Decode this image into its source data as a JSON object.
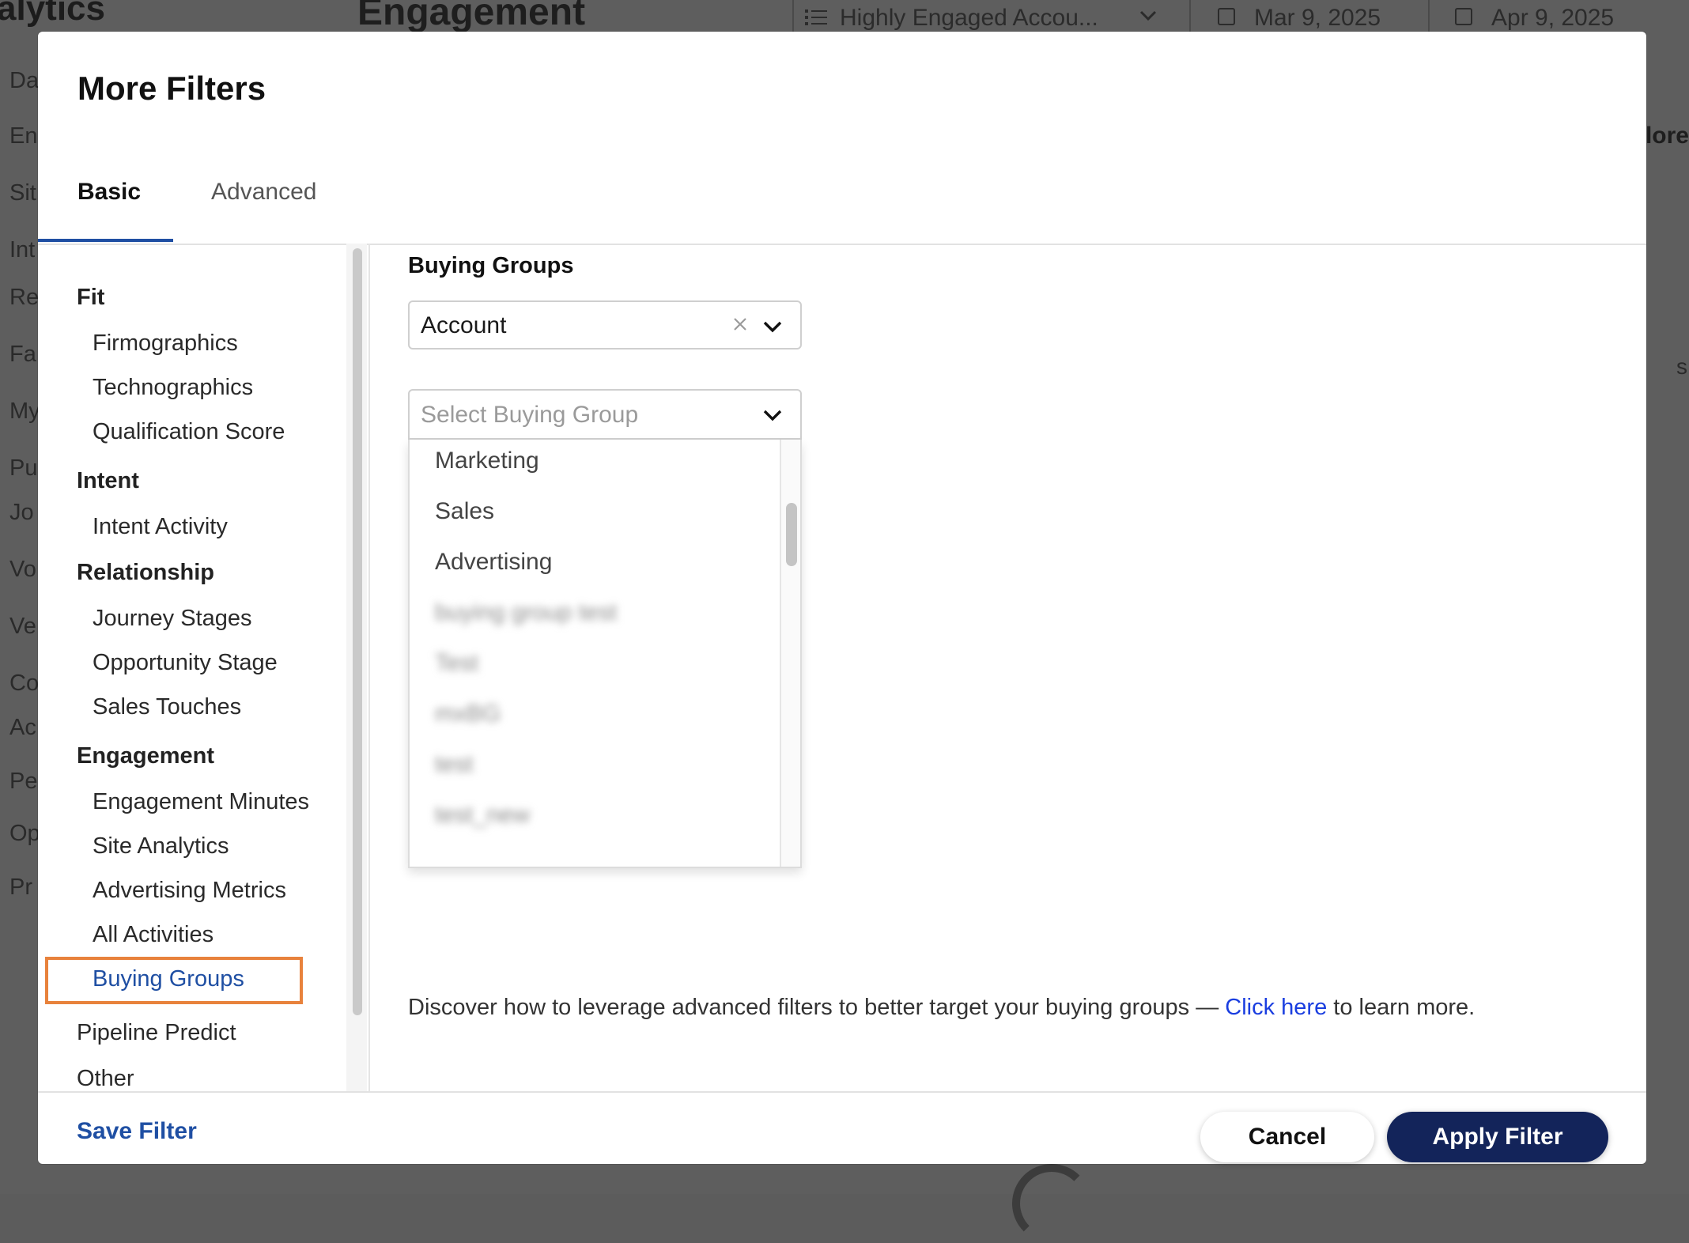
{
  "background": {
    "brand_fragment": "alytics",
    "page_title": "Engagement",
    "segment_filter": "Highly Engaged Accou...",
    "date_start": "Mar 9, 2025",
    "date_end": "Apr 9, 2025",
    "sidebar_fragments": [
      "Da",
      "En",
      "Sit",
      "Int",
      "Re",
      "Fa",
      "My",
      "Pu",
      "Jo",
      "Vo",
      "Ve",
      "Co",
      "Ac",
      "Pe",
      "Op",
      "Pr"
    ],
    "right_fragment": "lore",
    "right_fragment_2": "s"
  },
  "modal": {
    "title": "More Filters",
    "tabs": [
      {
        "label": "Basic",
        "active": true
      },
      {
        "label": "Advanced",
        "active": false
      }
    ],
    "nav": {
      "groups": [
        {
          "label": "Fit",
          "items": [
            "Firmographics",
            "Technographics",
            "Qualification Score"
          ]
        },
        {
          "label": "Intent",
          "items": [
            "Intent Activity"
          ]
        },
        {
          "label": "Relationship",
          "items": [
            "Journey Stages",
            "Opportunity Stage",
            "Sales Touches"
          ]
        },
        {
          "label": "Engagement",
          "items": [
            "Engagement Minutes",
            "Site Analytics",
            "Advertising Metrics",
            "All Activities",
            "Buying Groups"
          ]
        }
      ],
      "top_items": [
        "Pipeline Predict",
        "Other"
      ],
      "active_item": "Buying Groups"
    },
    "content": {
      "section_title": "Buying Groups",
      "entity_select_value": "Account",
      "group_select_placeholder": "Select Buying Group",
      "options": [
        "Marketing",
        "Sales",
        "Advertising",
        "buying group test",
        "Test",
        "mxBG",
        "test",
        "test_new"
      ],
      "hint_prefix": "Discover how to leverage advanced filters to better target your buying groups —",
      "hint_link": "Click here",
      "hint_suffix": "to learn more."
    },
    "footer": {
      "save_label": "Save Filter",
      "cancel_label": "Cancel",
      "apply_label": "Apply Filter"
    }
  },
  "colors": {
    "accent_blue": "#1f4fa3",
    "link_blue": "#1a3ee0",
    "apply_navy": "#13245a",
    "highlight_orange": "#e8823c"
  }
}
